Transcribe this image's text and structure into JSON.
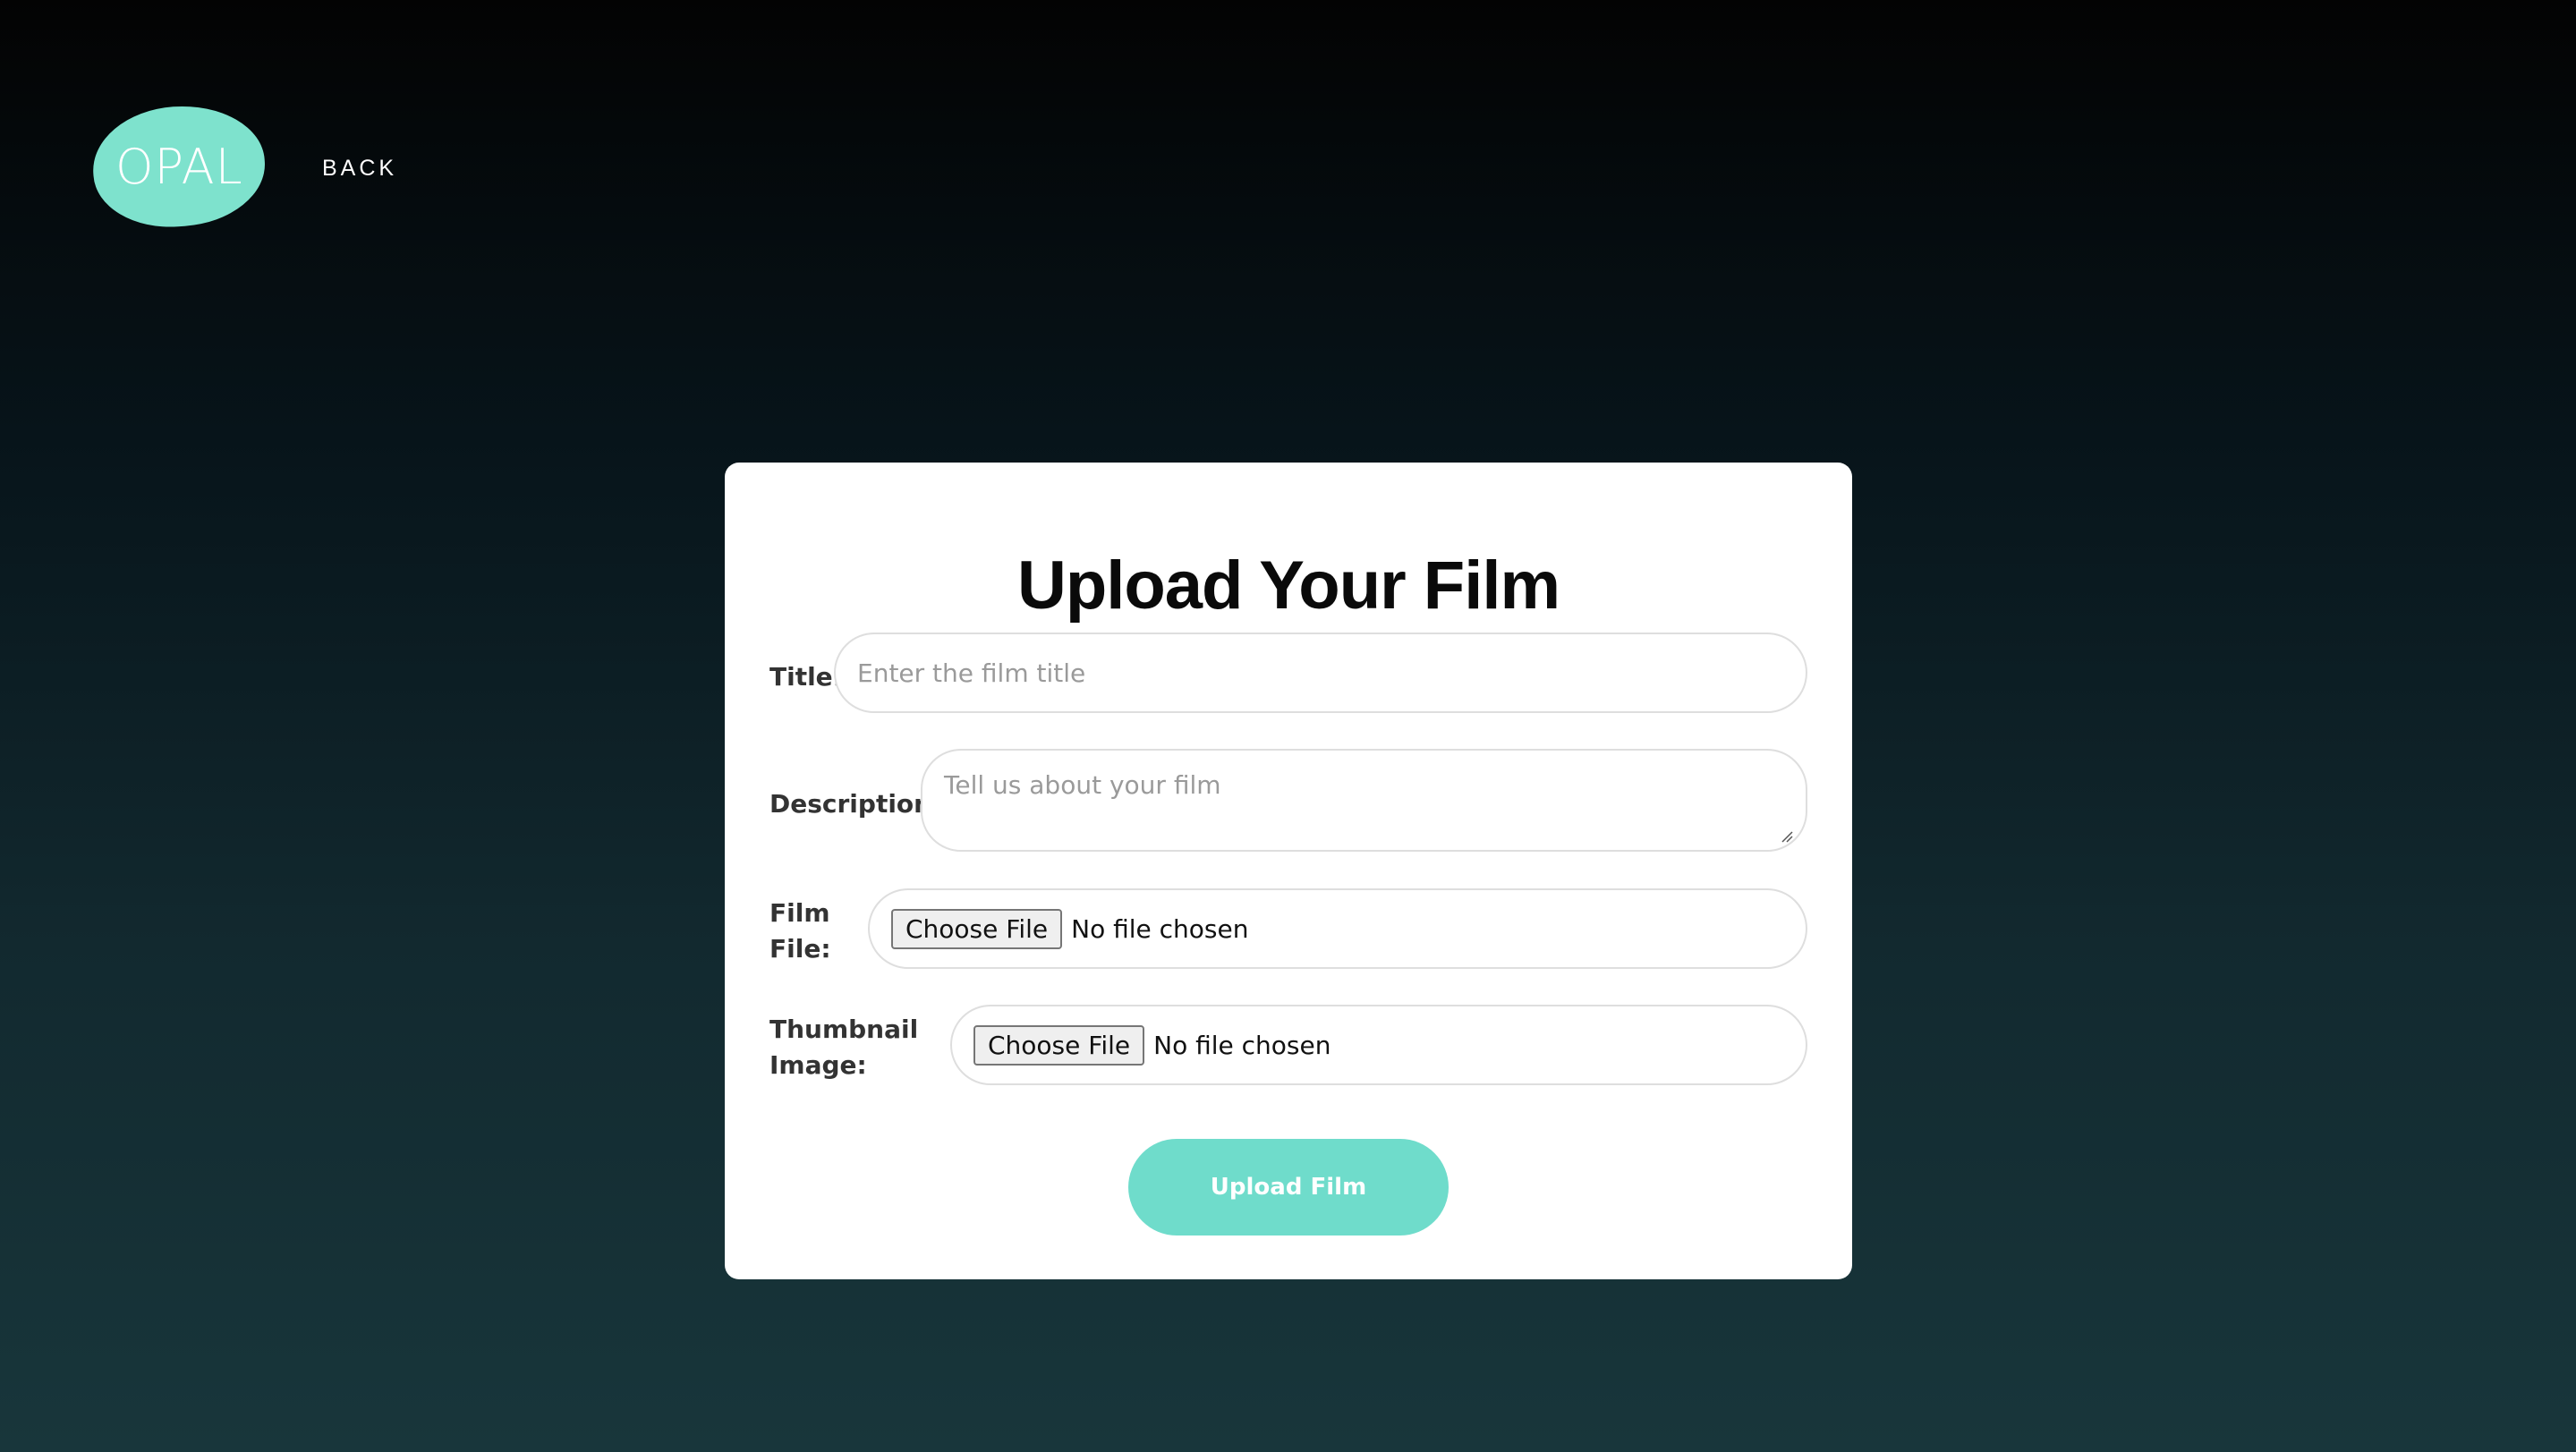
{
  "header": {
    "logo_text": "OPAL",
    "back_label": "BACK"
  },
  "form": {
    "heading": "Upload Your Film",
    "title_label": "Title:",
    "title_placeholder": "Enter the film title",
    "description_label": "Description:",
    "description_placeholder": "Tell us about your film",
    "film_file_label_line1": "Film",
    "film_file_label_line2": "File:",
    "thumbnail_label_line1": "Thumbnail",
    "thumbnail_label_line2": "Image:",
    "choose_file_label": "Choose File",
    "no_file_text": "No file chosen",
    "submit_label": "Upload Film"
  },
  "colors": {
    "accent": "#7ee2cd",
    "button": "#6fdccb",
    "background_top": "#030303",
    "background_bottom": "#18363b"
  }
}
